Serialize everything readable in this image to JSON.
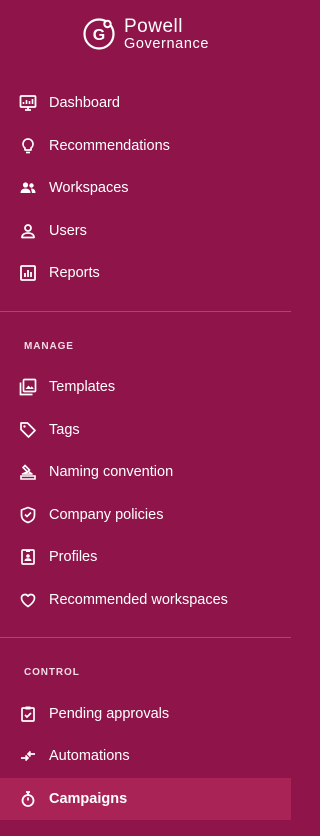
{
  "brand": {
    "mark": "G",
    "line1": "Powell",
    "line2": "Governance"
  },
  "nav_main": [
    {
      "label": "Dashboard",
      "icon": "dashboard-icon"
    },
    {
      "label": "Recommendations",
      "icon": "lightbulb-icon"
    },
    {
      "label": "Workspaces",
      "icon": "people-icon"
    },
    {
      "label": "Users",
      "icon": "user-icon"
    },
    {
      "label": "Reports",
      "icon": "chart-icon"
    }
  ],
  "manage": {
    "title": "MANAGE",
    "items": [
      {
        "label": "Templates",
        "icon": "images-icon"
      },
      {
        "label": "Tags",
        "icon": "tag-icon"
      },
      {
        "label": "Naming convention",
        "icon": "stamp-icon"
      },
      {
        "label": "Company policies",
        "icon": "shield-icon"
      },
      {
        "label": "Profiles",
        "icon": "id-badge-icon"
      },
      {
        "label": "Recommended workspaces",
        "icon": "heart-icon"
      }
    ]
  },
  "control": {
    "title": "CONTROL",
    "items": [
      {
        "label": "Pending approvals",
        "icon": "clipboard-check-icon"
      },
      {
        "label": "Automations",
        "icon": "arrows-icon"
      },
      {
        "label": "Campaigns",
        "icon": "stopwatch-icon",
        "active": true
      }
    ]
  },
  "colors": {
    "background": "#8e1449",
    "active": "#a92357",
    "divider": "#a8486f",
    "text": "#ffffff"
  }
}
